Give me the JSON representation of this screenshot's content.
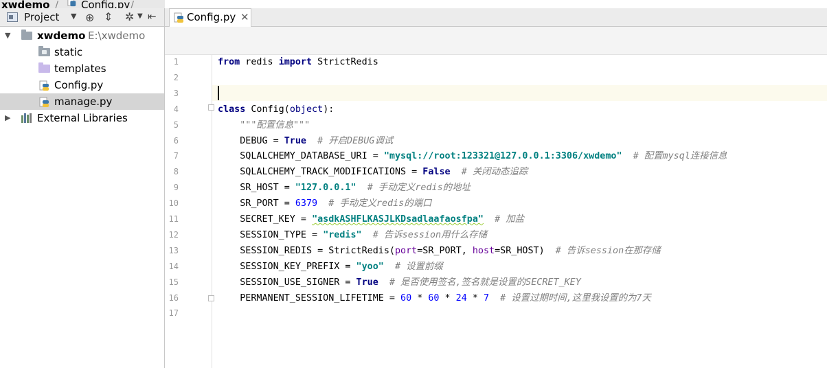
{
  "breadcrumb": {
    "project": "xwdemo",
    "file": "Config.py"
  },
  "project_panel": {
    "title": "Project",
    "tree": [
      {
        "label": "xwdemo",
        "path": "E:\\xwdemo",
        "kind": "root",
        "expanded": true
      },
      {
        "label": "static",
        "kind": "folder-static"
      },
      {
        "label": "templates",
        "kind": "folder-lav"
      },
      {
        "label": "Config.py",
        "kind": "py"
      },
      {
        "label": "manage.py",
        "kind": "py",
        "selected": true
      },
      {
        "label": "External Libraries",
        "kind": "lib",
        "expanded": false
      }
    ]
  },
  "editor": {
    "tab": {
      "label": "Config.py"
    },
    "line_numbers": [
      "1",
      "2",
      "3",
      "4",
      "5",
      "6",
      "7",
      "8",
      "9",
      "10",
      "11",
      "12",
      "13",
      "14",
      "15",
      "16",
      "17"
    ]
  },
  "code": {
    "lines": [
      [
        [
          "from",
          "kw"
        ],
        [
          " redis ",
          ""
        ],
        [
          "import",
          "kw"
        ],
        [
          " StrictRedis",
          ""
        ]
      ],
      [],
      [],
      [
        [
          "class",
          "kw"
        ],
        [
          " Config(",
          ""
        ],
        [
          "object",
          "bi"
        ],
        [
          "):",
          ""
        ]
      ],
      [
        [
          "    ",
          ""
        ],
        [
          "\"\"\"配置信息\"\"\"",
          "doc"
        ]
      ],
      [
        [
          "    DEBUG = ",
          ""
        ],
        [
          "True",
          "kw"
        ],
        [
          "  ",
          ""
        ],
        [
          "# 开启DEBUG调试",
          "cm"
        ]
      ],
      [
        [
          "    SQLALCHEMY_DATABASE_URI = ",
          ""
        ],
        [
          "\"mysql://root:123321@127.0.0.1:3306/xwdemo\"",
          "str"
        ],
        [
          "  ",
          ""
        ],
        [
          "# 配置mysql连接信息",
          "cm"
        ]
      ],
      [
        [
          "    SQLALCHEMY_TRACK_MODIFICATIONS = ",
          ""
        ],
        [
          "False",
          "kw"
        ],
        [
          "  ",
          ""
        ],
        [
          "# 关闭动态追踪",
          "cm"
        ]
      ],
      [
        [
          "    SR_HOST = ",
          ""
        ],
        [
          "\"127.0.0.1\"",
          "str"
        ],
        [
          "  ",
          ""
        ],
        [
          "# 手动定义redis的地址",
          "cm"
        ]
      ],
      [
        [
          "    SR_PORT = ",
          ""
        ],
        [
          "6379",
          "num"
        ],
        [
          "  ",
          ""
        ],
        [
          "# 手动定义redis的端口",
          "cm"
        ]
      ],
      [
        [
          "    SECRET_KEY = ",
          ""
        ],
        [
          "\"asdkASHFLKASJLKDsadlaafaosfpa\"",
          "str squig"
        ],
        [
          "  ",
          ""
        ],
        [
          "# 加盐",
          "cm"
        ]
      ],
      [
        [
          "    SESSION_TYPE = ",
          ""
        ],
        [
          "\"redis\"",
          "str"
        ],
        [
          "  ",
          ""
        ],
        [
          "# 告诉session用什么存储",
          "cm"
        ]
      ],
      [
        [
          "    SESSION_REDIS = StrictRedis(",
          ""
        ],
        [
          "port",
          "par"
        ],
        [
          "=SR_PORT, ",
          ""
        ],
        [
          "host",
          "par"
        ],
        [
          "=SR_HOST)  ",
          ""
        ],
        [
          "# 告诉session在那存储",
          "cm"
        ]
      ],
      [
        [
          "    SESSION_KEY_PREFIX = ",
          ""
        ],
        [
          "\"yoo\"",
          "str"
        ],
        [
          "  ",
          ""
        ],
        [
          "# 设置前缀",
          "cm"
        ]
      ],
      [
        [
          "    SESSION_USE_SIGNER = ",
          ""
        ],
        [
          "True",
          "kw"
        ],
        [
          "  ",
          ""
        ],
        [
          "# 是否使用签名,签名就是设置的SECRET_KEY",
          "cm"
        ]
      ],
      [
        [
          "    PERMANENT_SESSION_LIFETIME = ",
          ""
        ],
        [
          "60",
          "num"
        ],
        [
          " * ",
          ""
        ],
        [
          "60",
          "num"
        ],
        [
          " * ",
          ""
        ],
        [
          "24",
          "num"
        ],
        [
          " * ",
          ""
        ],
        [
          "7",
          "num"
        ],
        [
          "  ",
          ""
        ],
        [
          "# 设置过期时间,这里我设置的为7天",
          "cm"
        ]
      ],
      []
    ]
  }
}
